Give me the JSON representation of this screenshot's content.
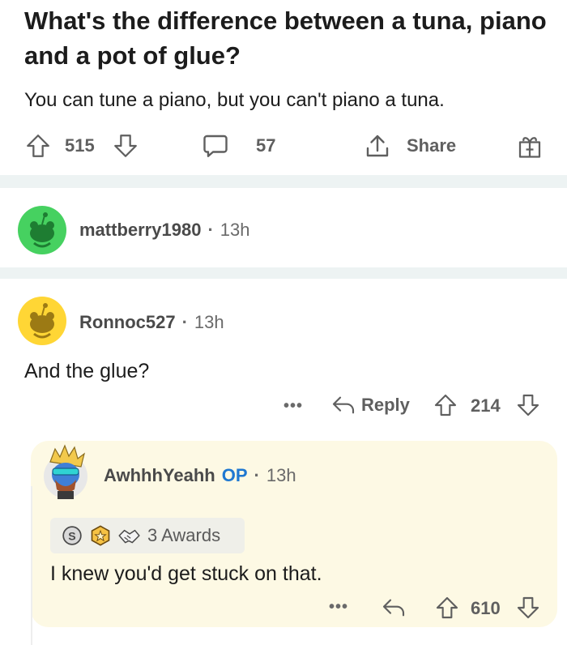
{
  "post": {
    "title": "What's the difference between a tuna, piano and a pot of glue?",
    "body": "You can tune a piano, but you can't piano a tuna.",
    "score": "515",
    "comments": "57",
    "share_label": "Share"
  },
  "comments": [
    {
      "username": "mattberry1980",
      "time": "13h",
      "avatar_color": "#46d160"
    },
    {
      "username": "Ronnoc527",
      "time": "13h",
      "avatar_color": "#ffd635",
      "text": "And the glue?",
      "more": "•••",
      "reply_label": "Reply",
      "score": "214"
    }
  ],
  "reply": {
    "username": "AwhhhYeahh",
    "op_label": "OP",
    "time": "13h",
    "awards_label": "3 Awards",
    "text": "I knew you'd get stuck on that.",
    "more": "•••",
    "score": "610",
    "card_color": "#fdf9e4"
  },
  "separator": "·"
}
